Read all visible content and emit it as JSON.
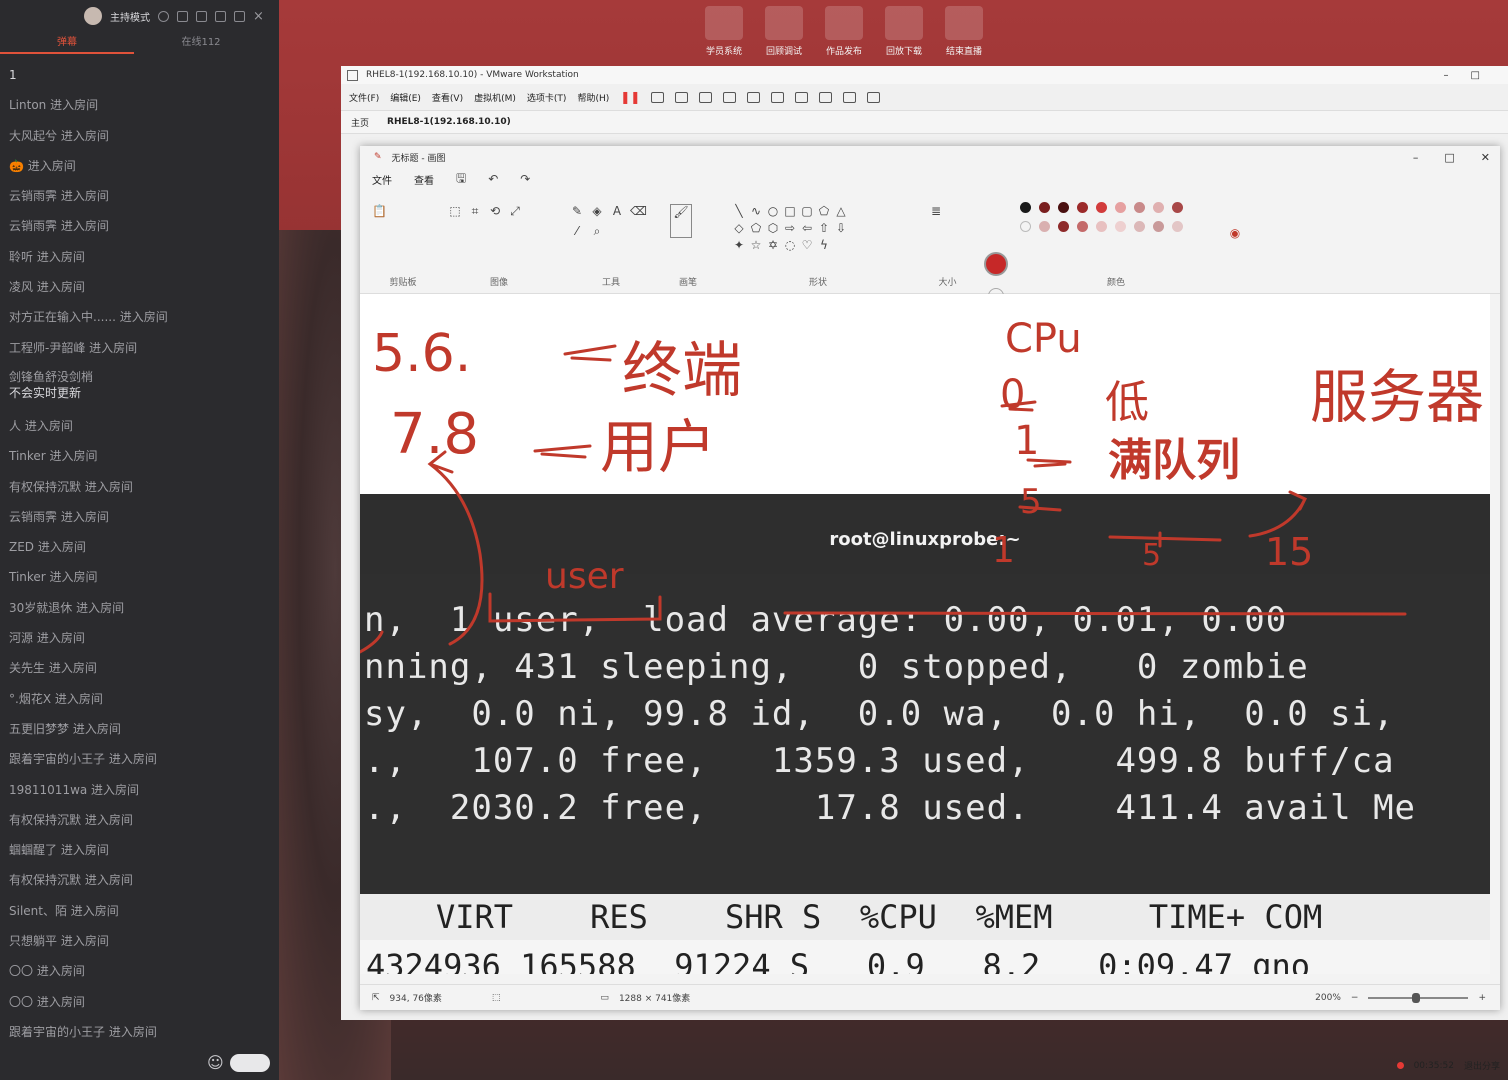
{
  "chat": {
    "header_mode": "主持模式",
    "tabs": [
      "弹幕",
      "在线112"
    ],
    "messages": [
      "1",
      "Linton 进入房间",
      "大风起兮 进入房间",
      "🎃 进入房间",
      "云销雨霁 进入房间",
      "云销雨霁 进入房间",
      "聆听 进入房间",
      "凌风 进入房间",
      "对方正在输入中...... 进入房间",
      "工程师-尹韶峰 进入房间"
    ],
    "two_line_message": {
      "line1": "剑锋鱼舒没剑梢",
      "line2": "不会实时更新"
    },
    "messages_after": [
      "人 进入房间",
      "Tinker 进入房间",
      "有权保持沉默 进入房间",
      "云销雨霁 进入房间",
      "ZED 进入房间",
      "Tinker 进入房间",
      "30岁就退休 进入房间",
      "河源 进入房间",
      "关先生 进入房间",
      "°.烟花X 进入房间",
      "五更旧梦梦 进入房间",
      "跟着宇宙的小王子 进入房间",
      "19811011wa 进入房间",
      "有权保持沉默 进入房间",
      "蝈蝈醒了 进入房间",
      "有权保持沉默 进入房间",
      "Silent、陌 进入房间",
      "只想躺平 进入房间",
      "〇〇 进入房间",
      "〇〇 进入房间",
      "跟着宇宙的小王子 进入房间"
    ],
    "smile_icon": "☺"
  },
  "desktop_icons": [
    "学员系统",
    "回顾调试",
    "作品发布",
    "回放下载",
    "结束直播"
  ],
  "vmware": {
    "title": "RHEL8-1(192.168.10.10) - VMware Workstation",
    "menu": [
      "文件(F)",
      "编辑(E)",
      "查看(V)",
      "虚拟机(M)",
      "选项卡(T)",
      "帮助(H)"
    ],
    "tabs": {
      "home": "主页",
      "vm": "RHEL8-1(192.168.10.10)"
    }
  },
  "paint": {
    "title": "无标题 - 画图",
    "menu": [
      "文件",
      "查看"
    ],
    "groups": [
      "剪贴板",
      "图像",
      "工具",
      "画笔",
      "形状",
      "大小",
      "颜色"
    ],
    "status": {
      "cursor": "934, 76像素",
      "size": "1288 × 741像素",
      "zoom": "200%"
    },
    "colors": [
      "#1a1a1a",
      "#7a1f1f",
      "#4a1010",
      "#9c2a2a",
      "#d23b3b",
      "#e6a0a0",
      "#c98a8a",
      "#e0b0b0",
      "#a84848",
      "#c46a6a"
    ]
  },
  "terminal": {
    "title": "root@linuxprobe:~",
    "line1": "n,  1 user,  load average: 0.00, 0.01, 0.00",
    "line2": "nning, 431 sleeping,   0 stopped,   0 zombie",
    "line3": "sy,  0.0 ni, 99.8 id,  0.0 wa,  0.0 hi,  0.0 si,",
    "line4": ".,   107.0 free,   1359.3 used,    499.8 buff/ca",
    "line5": ".,  2030.2 free,     17.8 used.    411.4 avail Me",
    "header": "VIRT    RES    SHR S  %CPU  %MEM     TIME+ COM",
    "row": "4324936 165588  91224 S   0.9   8.2   0:09.47 gno"
  },
  "annotations": {
    "a1": "5.6.",
    "a2": "终端",
    "a3": "7.8",
    "a4": "用户",
    "a5": "CPu",
    "a6": "0",
    "a7": "低",
    "a8": "服务器",
    "a9": "1",
    "a10": "满队列",
    "a11": "5",
    "a12": "user",
    "a13": "1",
    "a14": "5",
    "a15": "15"
  },
  "recording": {
    "time": "00:35:52",
    "exit": "退出分享"
  }
}
